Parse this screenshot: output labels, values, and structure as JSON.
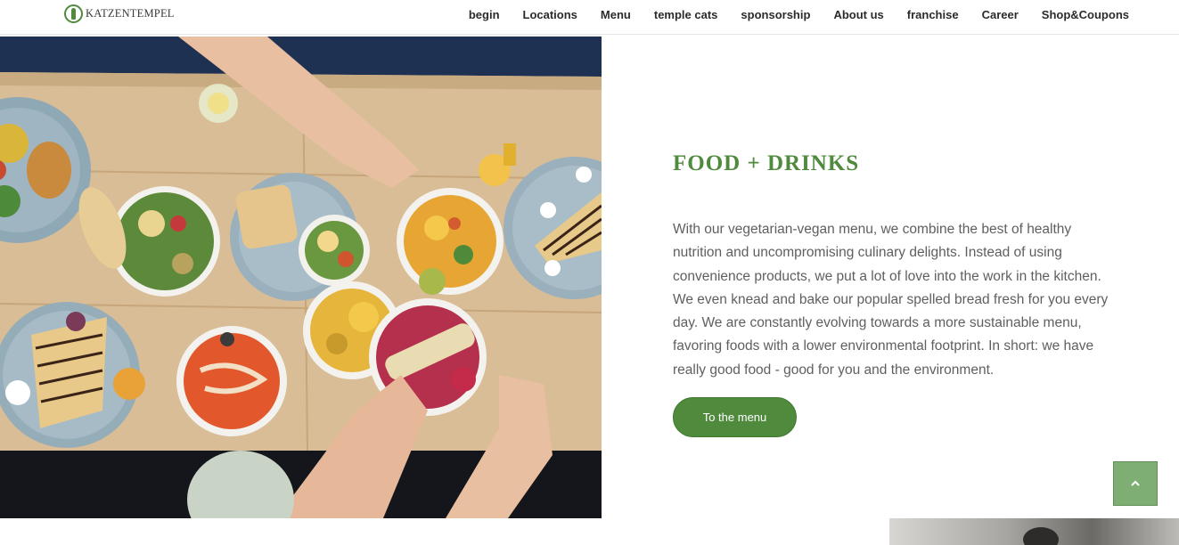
{
  "header": {
    "logo_text": "KATZENTEMPEL",
    "nav": [
      "begin",
      "Locations",
      "Menu",
      "temple cats",
      "sponsorship",
      "About us",
      "franchise",
      "Career",
      "Shop&Coupons"
    ]
  },
  "hero": {
    "image_alt": "Table with vegetarian bowls, salads and drinks"
  },
  "section": {
    "title": "FOOD + DRINKS",
    "body": "With our vegetarian-vegan menu, we combine the best of healthy nutrition and uncompromising culinary delights. Instead of using convenience products, we put a lot of love into the work in the kitchen. We even knead and bake our popular spelled bread fresh for you every day. We are constantly evolving towards a more sustainable menu, favoring foods with a lower environmental footprint. In short: we have really good food - good for you and the environment.",
    "button_label": "To the menu"
  },
  "colors": {
    "brand_green": "#4f8a3d",
    "scroll_button": "#7fae74"
  },
  "icons": {
    "scroll_top": "chevron-up-icon",
    "logo": "cat-temple-logo-icon"
  }
}
